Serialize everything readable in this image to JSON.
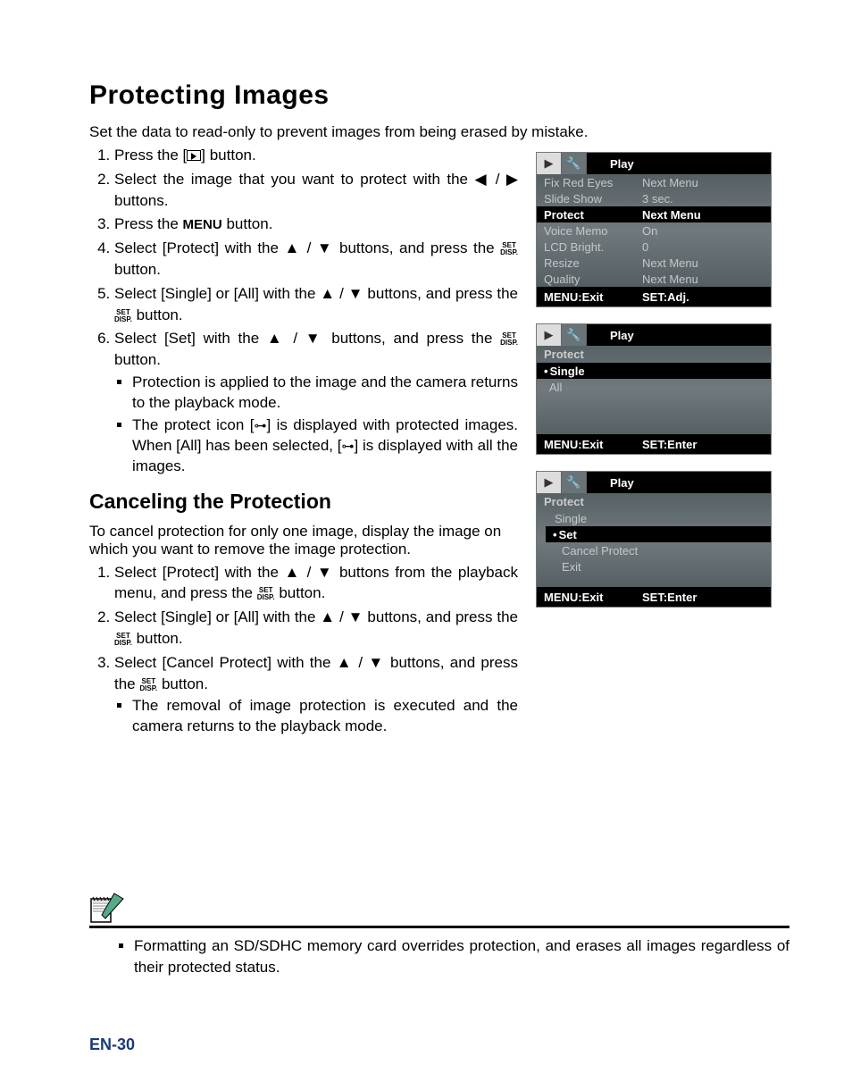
{
  "h1": "Protecting Images",
  "intro": "Set the data to read-only to prevent images from being erased by mistake.",
  "steps_a": [
    "Press the [▶] button.",
    "Select the image that you want to protect with the ◀ / ▶ buttons.",
    "Press the MENU button.",
    "Select [Protect] with the ▲ / ▼ buttons, and press the SET/DISP. button.",
    "Select [Single] or [All] with the ▲ / ▼ buttons, and press the SET/DISP. button.",
    "Select [Set] with the ▲ / ▼ buttons, and press the SET/DISP. button."
  ],
  "bullets_a": [
    "Protection is applied to the image and the camera returns to the playback mode.",
    "The protect icon [🔑] is displayed with protected images. When [All] has been selected, [🔑] is displayed with all the images."
  ],
  "h2": "Canceling the Protection",
  "cancel_intro": "To cancel protection for only one image, display the image on which you want to remove the image protection.",
  "steps_b": [
    "Select [Protect] with the ▲ / ▼ buttons from the playback menu, and press the SET/DISP. button.",
    "Select [Single] or [All] with the ▲ / ▼ buttons, and press the SET/DISP. button.",
    "Select [Cancel Protect] with the ▲ / ▼ buttons, and press the SET/DISP. button."
  ],
  "bullets_b": [
    "The removal of image protection is executed and the camera returns to the playback mode."
  ],
  "note": "Formatting an SD/SDHC memory card overrides protection, and erases all images regardless of their protected status.",
  "footer": "EN-30",
  "cam1": {
    "title": "Play",
    "rows": [
      {
        "k": "Fix Red Eyes",
        "v": "Next Menu"
      },
      {
        "k": "Slide Show",
        "v": "3 sec."
      },
      {
        "k": "Protect",
        "v": "Next Menu",
        "hl": true
      },
      {
        "k": "Voice Memo",
        "v": "On"
      },
      {
        "k": "LCD Bright.",
        "v": "0"
      },
      {
        "k": "Resize",
        "v": "Next Menu"
      },
      {
        "k": "Quality",
        "v": "Next Menu"
      }
    ],
    "f1": "MENU:Exit",
    "f2": "SET:Adj."
  },
  "cam2": {
    "title": "Play",
    "heading": "Protect",
    "items": [
      {
        "label": "Single",
        "hl": true
      },
      {
        "label": "All"
      }
    ],
    "f1": "MENU:Exit",
    "f2": "SET:Enter"
  },
  "cam3": {
    "title": "Play",
    "heading": "Protect",
    "sub": "Single",
    "items": [
      {
        "label": "Set",
        "hl": true
      },
      {
        "label": "Cancel Protect"
      },
      {
        "label": "Exit"
      }
    ],
    "f1": "MENU:Exit",
    "f2": "SET:Enter"
  }
}
